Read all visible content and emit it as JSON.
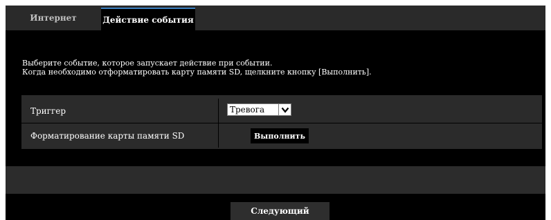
{
  "tabs": [
    {
      "label": "Интернет",
      "active": false
    },
    {
      "label": "Действие события",
      "active": true
    }
  ],
  "intro": {
    "line1": "Выберите событие, которое запускает действие при событии.",
    "line2": "Когда необходимо отформатировать карту памяти SD, щелкните кнопку [Выполнить]."
  },
  "settings": {
    "trigger_label": "Триггер",
    "trigger_value": "Тревога",
    "format_label": "Форматирование карты памяти SD",
    "execute_label": "Выполнить"
  },
  "footer": {
    "next_label": "Следующий"
  },
  "colors": {
    "background": "#000000",
    "panel": "#2b2b2b",
    "tab_bar": "#2a2a2a",
    "active_tab_accent": "#3a7fc0"
  }
}
